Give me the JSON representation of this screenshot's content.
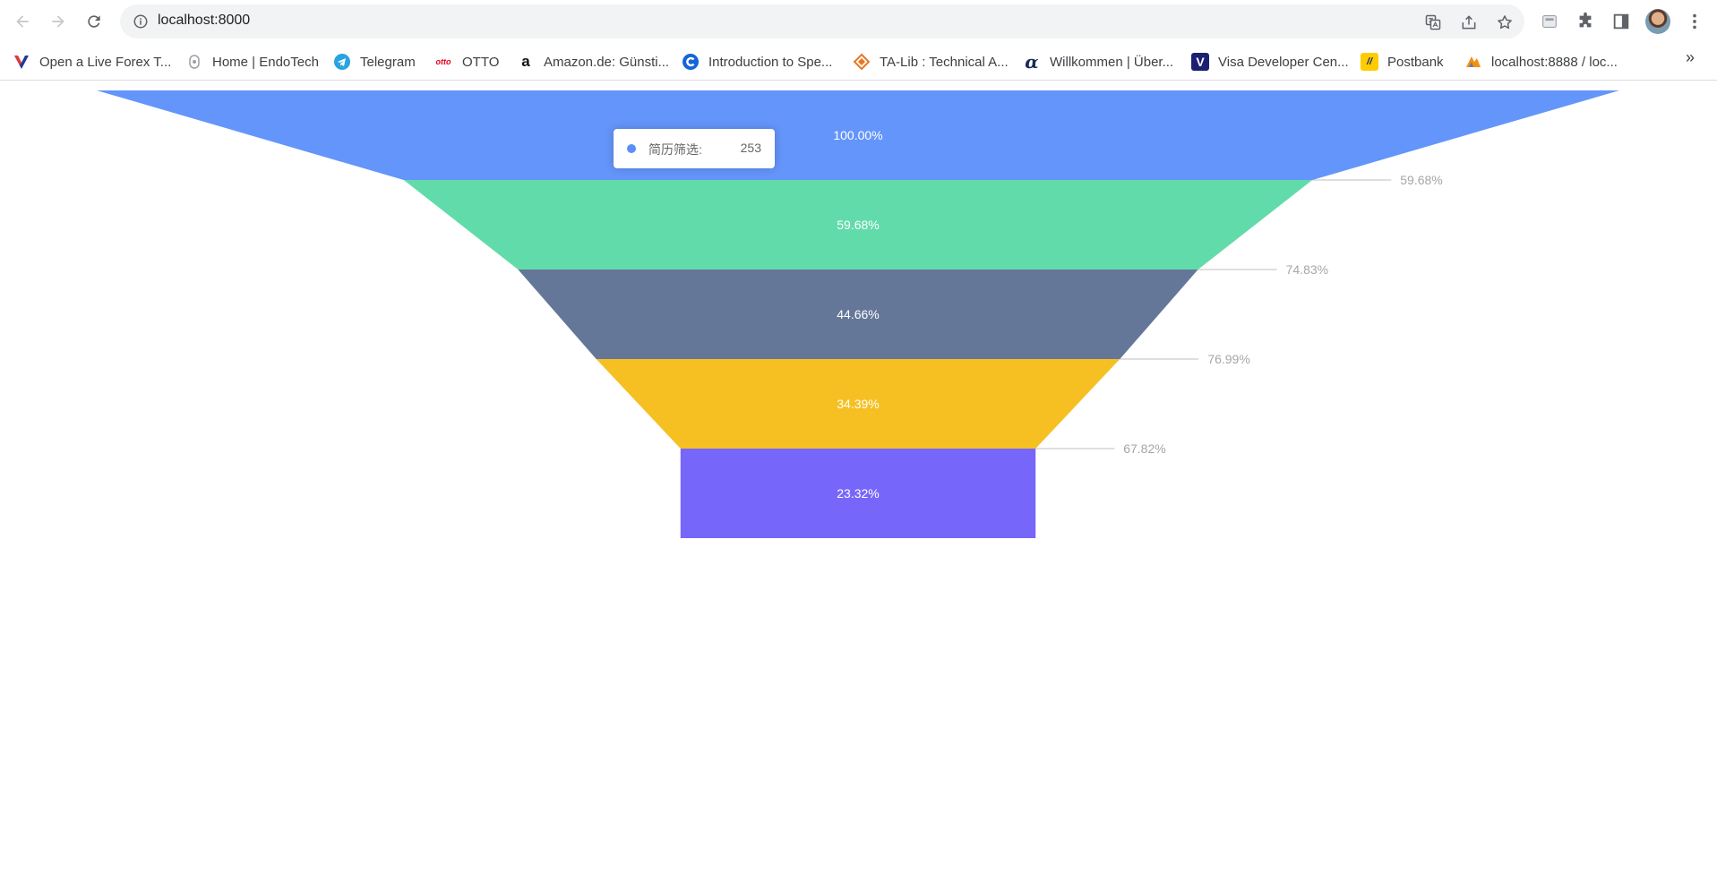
{
  "browser": {
    "url": "localhost:8000",
    "bookmarks": [
      {
        "label": "Open a Live Forex T...",
        "icon": "vantage-icon",
        "color": "#1f3a93"
      },
      {
        "label": "Home | EndoTech",
        "icon": "endotech-icon",
        "color": "#9aa0a6"
      },
      {
        "label": "Telegram",
        "icon": "telegram-icon",
        "color": "#2aa3df"
      },
      {
        "label": "OTTO",
        "icon": "otto-icon",
        "color": "#e10019"
      },
      {
        "label": "Amazon.de: Günsti...",
        "icon": "amazon-icon",
        "color": "#111111"
      },
      {
        "label": "Introduction to Spe...",
        "icon": "coursera-icon",
        "color": "#1565d8"
      },
      {
        "label": "TA-Lib : Technical A...",
        "icon": "talib-icon",
        "color": "#e87722"
      },
      {
        "label": "Willkommen | Über...",
        "icon": "alpha-icon",
        "color": "#1a2a5a"
      },
      {
        "label": "Visa Developer Cen...",
        "icon": "visa-icon",
        "color": "#1a1f71"
      },
      {
        "label": "Postbank",
        "icon": "postbank-icon",
        "color": "#ffcc00"
      },
      {
        "label": "localhost:8888 / loc...",
        "icon": "phpmyadmin-icon",
        "color": "#f29111"
      }
    ],
    "more_label": "»"
  },
  "tooltip": {
    "name": "简历筛选:",
    "value": "253",
    "color": "#5b8ff9"
  },
  "chart_data": {
    "type": "funnel",
    "colors": [
      "#6495fa",
      "#62dbab",
      "#657798",
      "#f6c022",
      "#7766fa"
    ],
    "stages": [
      {
        "label": "100.00%",
        "conversion": ""
      },
      {
        "label": "59.68%",
        "conversion": "59.68%"
      },
      {
        "label": "44.66%",
        "conversion": "74.83%"
      },
      {
        "label": "34.39%",
        "conversion": "76.99%"
      },
      {
        "label": "23.32%",
        "conversion": "67.82%"
      }
    ],
    "values_percent": [
      100.0,
      59.68,
      44.66,
      34.39,
      23.32
    ],
    "conversion_rates_percent": [
      null,
      59.68,
      74.83,
      76.99,
      67.82
    ]
  }
}
